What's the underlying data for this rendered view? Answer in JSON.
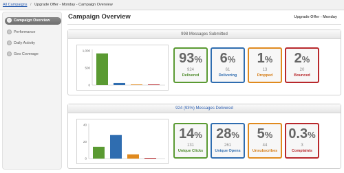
{
  "breadcrumb": {
    "root": "All Campaigns",
    "separator": "/",
    "current": "Upgrade Offer - Monday - Campaign Overview"
  },
  "sidebar": {
    "items": [
      {
        "label": "Campaign Overview",
        "active": true,
        "icon": "overview-icon"
      },
      {
        "label": "Performance",
        "active": false,
        "icon": "performance-icon"
      },
      {
        "label": "Daily Activity",
        "active": false,
        "icon": "daily-activity-icon"
      },
      {
        "label": "Geo Coverage",
        "active": false,
        "icon": "geo-coverage-icon"
      }
    ]
  },
  "header": {
    "title": "Campaign Overview",
    "campaign_name": "Upgrade Offer - Monday"
  },
  "submitted": {
    "header": "998 Messages Submitted",
    "stats": [
      {
        "pct": "93",
        "count": "924",
        "label": "Delivered",
        "color": "#5a9a32"
      },
      {
        "pct": "6",
        "count": "61",
        "label": "Delivering",
        "color": "#2f6db0"
      },
      {
        "pct": "1",
        "count": "13",
        "label": "Dropped",
        "color": "#e08a1e"
      },
      {
        "pct": "2",
        "count": "20",
        "label": "Bounced",
        "color": "#b8282b"
      }
    ]
  },
  "delivered": {
    "header": "924 (93%) Messages Delivered",
    "stats": [
      {
        "pct": "14",
        "count": "131",
        "label": "Unique Clicks",
        "color": "#5a9a32"
      },
      {
        "pct": "28",
        "count": "261",
        "label": "Unique Opens",
        "color": "#2f6db0"
      },
      {
        "pct": "5",
        "count": "44",
        "label": "Unsubscribes",
        "color": "#e08a1e"
      },
      {
        "pct": "0.3",
        "count": "3",
        "label": "Complaints",
        "color": "#b8282b"
      }
    ]
  },
  "percent_symbol": "%",
  "colors": {
    "green": "#5a9a32",
    "blue": "#2f6db0",
    "orange": "#e08a1e",
    "red": "#b8282b",
    "link": "#2a5db0"
  },
  "chart_data": [
    {
      "type": "bar",
      "categories": [
        "Delivered",
        "Delivering",
        "Dropped",
        "Bounced"
      ],
      "values": [
        924,
        61,
        13,
        20
      ],
      "colors": [
        "#5a9a32",
        "#2f6db0",
        "#e08a1e",
        "#b8282b"
      ],
      "yticks": [
        "1,000",
        "500",
        "0"
      ],
      "ylim": [
        0,
        1000
      ],
      "grid": false
    },
    {
      "type": "bar",
      "categories": [
        "Unique Clicks",
        "Unique Opens",
        "Unsubscribes",
        "Complaints"
      ],
      "values": [
        14,
        28,
        5,
        0.3
      ],
      "colors": [
        "#5a9a32",
        "#2f6db0",
        "#e08a1e",
        "#b8282b"
      ],
      "yticks": [
        "40",
        "20",
        "0"
      ],
      "ylim": [
        0,
        40
      ],
      "grid": false
    }
  ]
}
